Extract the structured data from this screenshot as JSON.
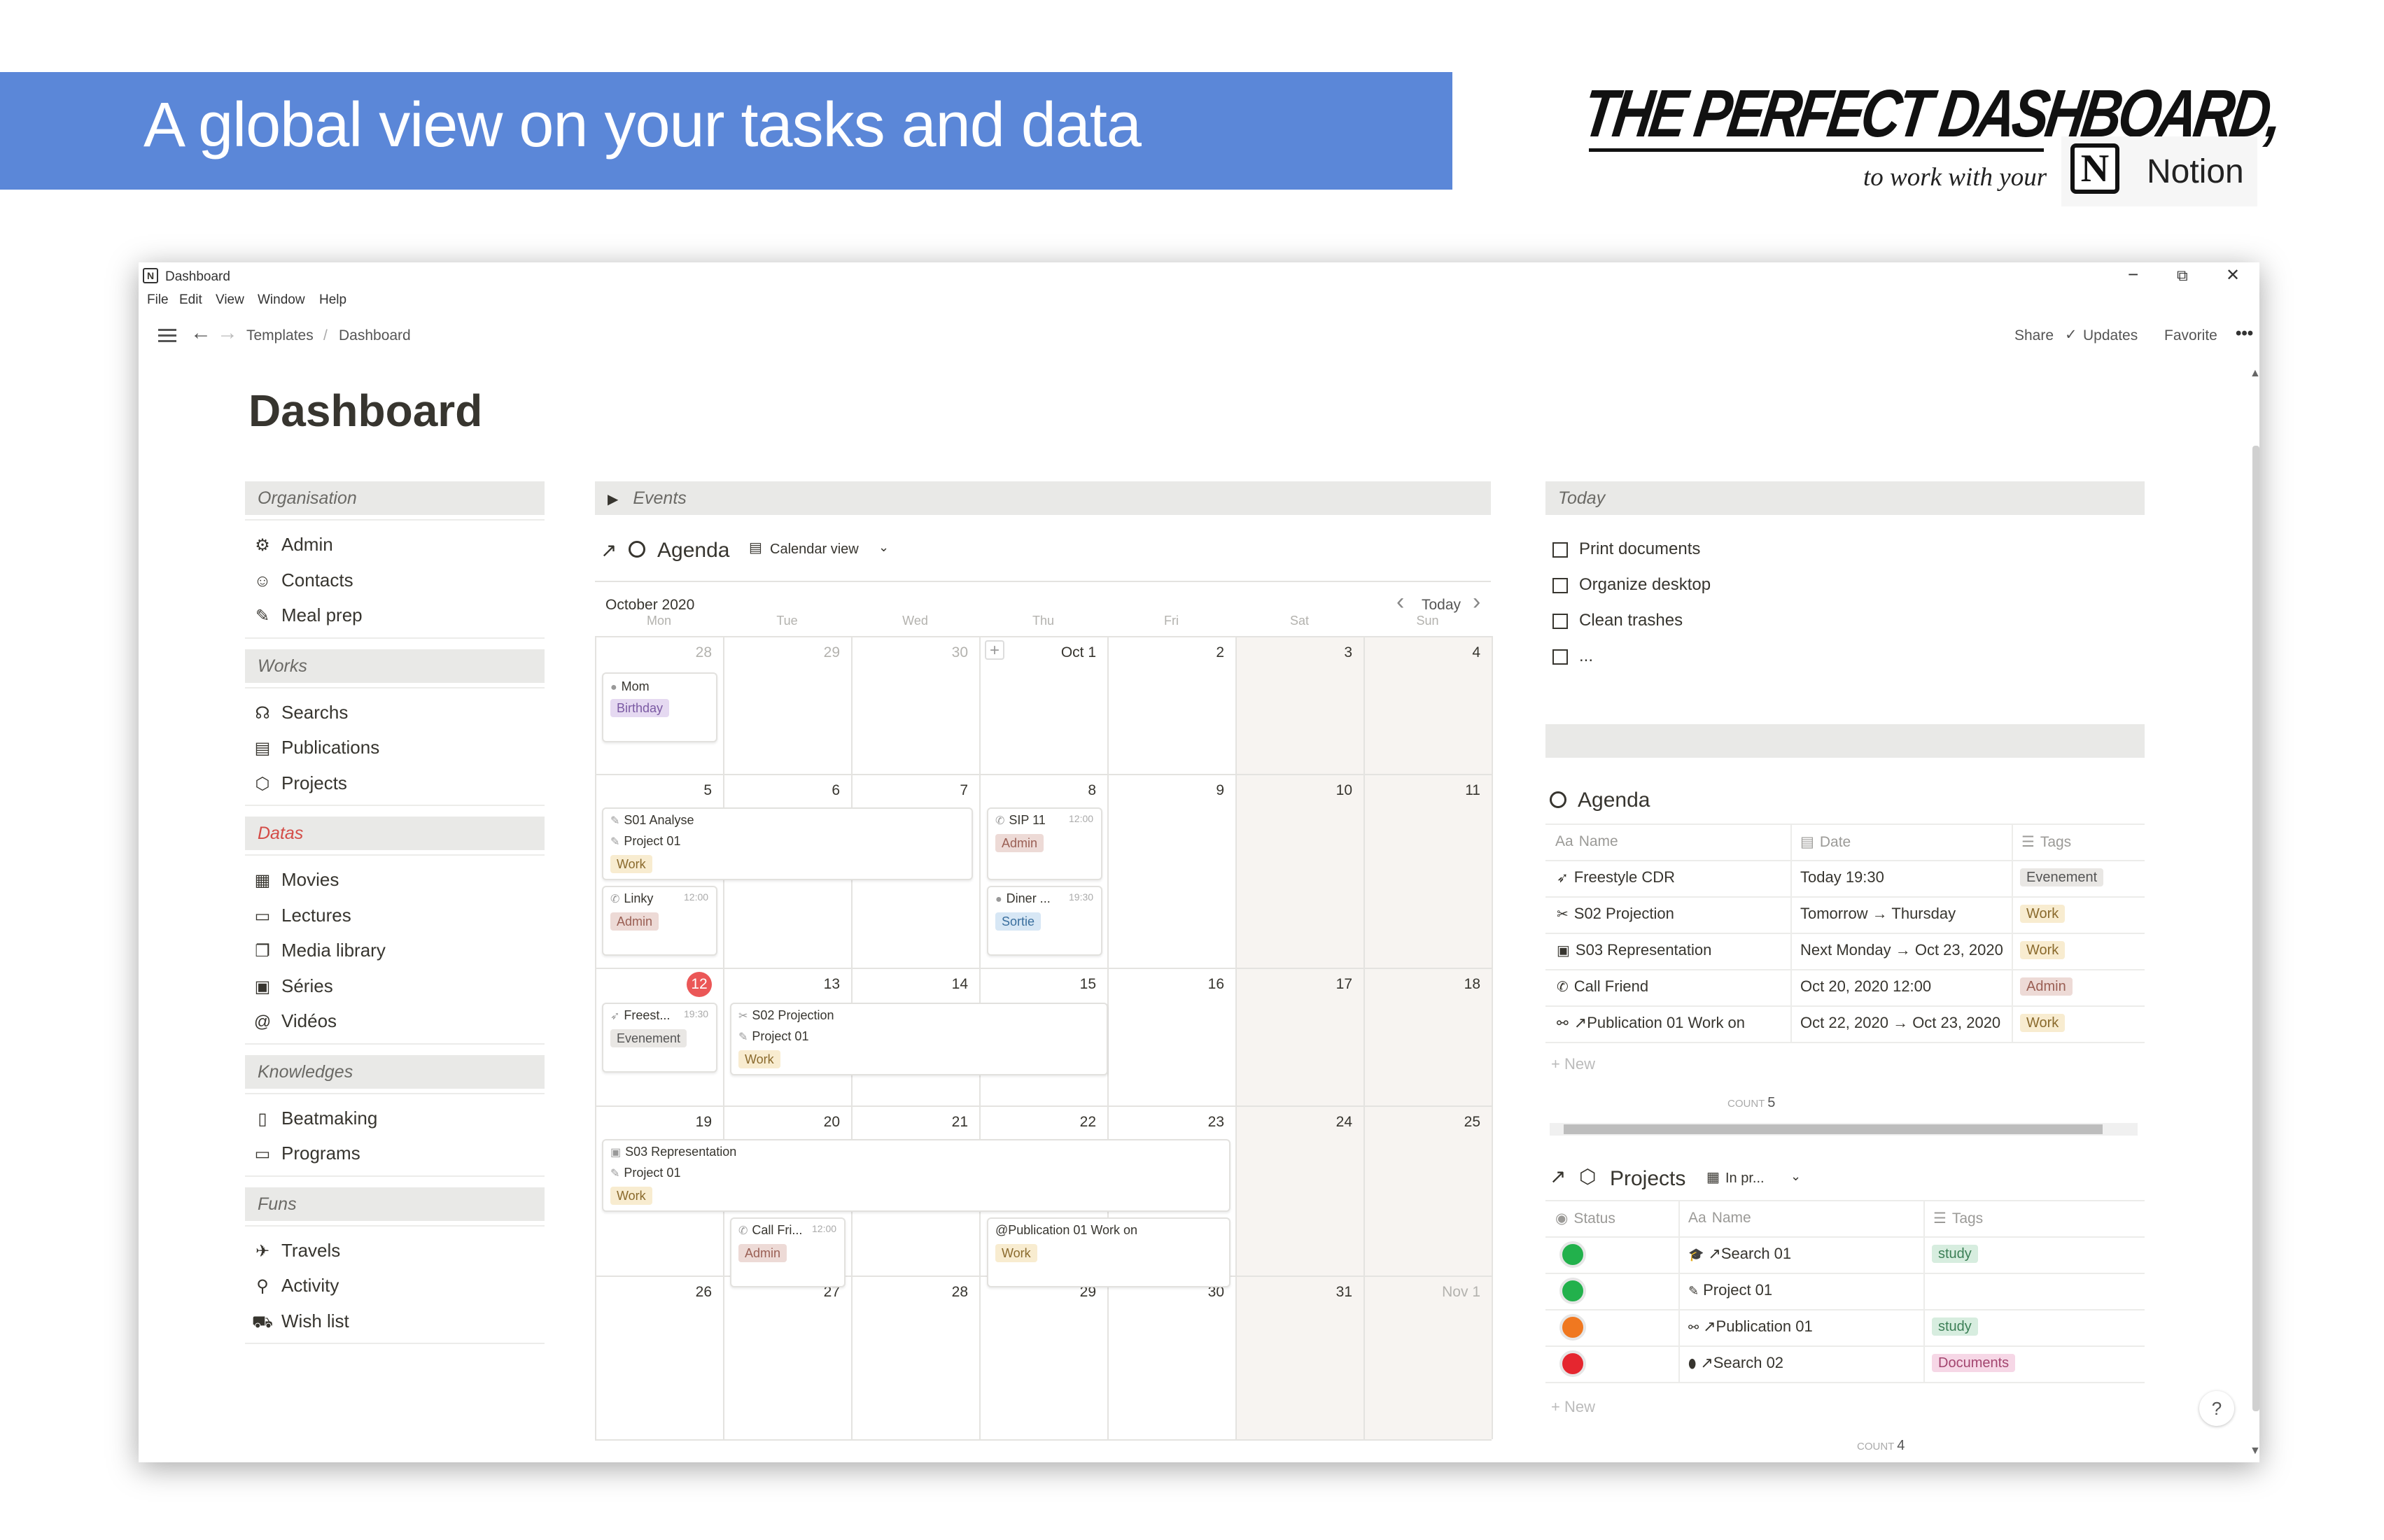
{
  "banner": {
    "title": "A global view on your tasks and data"
  },
  "brand": {
    "title": "THE PERFECT DASHBOARD,",
    "subtitle": "to work with your",
    "notion_logo": "N",
    "notion_word": "Notion"
  },
  "window": {
    "title": "Dashboard",
    "app_icon": "N",
    "menu": [
      "File",
      "Edit",
      "View",
      "Window",
      "Help"
    ],
    "controls": {
      "minimize": "−",
      "restore": "⧉",
      "close": "✕"
    }
  },
  "topbar": {
    "breadcrumb": [
      "Templates",
      "/",
      "Dashboard"
    ],
    "actions": {
      "share": "Share",
      "updates": "Updates",
      "favorite": "Favorite",
      "more": "•••"
    }
  },
  "page": {
    "title": "Dashboard"
  },
  "sidebar": {
    "sections": [
      {
        "title": "Organisation",
        "color": "#6b6a66",
        "items": [
          {
            "icon": "gear-icon",
            "glyph": "⚙",
            "label": "Admin"
          },
          {
            "icon": "person-icon",
            "glyph": "☺",
            "label": "Contacts"
          },
          {
            "icon": "pen-icon",
            "glyph": "✎",
            "label": "Meal prep"
          }
        ]
      },
      {
        "title": "Works",
        "color": "#6b6a66",
        "items": [
          {
            "icon": "headphones-icon",
            "glyph": "☊",
            "label": "Searchs"
          },
          {
            "icon": "clipboard-icon",
            "glyph": "▤",
            "label": "Publications"
          },
          {
            "icon": "cube-icon",
            "glyph": "⬡",
            "label": "Projects"
          }
        ]
      },
      {
        "title": "Datas",
        "color": "#d44c47",
        "items": [
          {
            "icon": "film-icon",
            "glyph": "▦",
            "label": "Movies"
          },
          {
            "icon": "book-icon",
            "glyph": "▭",
            "label": "Lectures"
          },
          {
            "icon": "media-icon",
            "glyph": "❐",
            "label": "Media library"
          },
          {
            "icon": "tv-icon",
            "glyph": "▣",
            "label": "Séries"
          },
          {
            "icon": "at-icon",
            "glyph": "@",
            "label": "Vidéos"
          }
        ]
      },
      {
        "title": "Knowledges",
        "color": "#6b6a66",
        "items": [
          {
            "icon": "speaker-icon",
            "glyph": "▯",
            "label": "Beatmaking"
          },
          {
            "icon": "monitor-icon",
            "glyph": "▭",
            "label": "Programs"
          }
        ]
      },
      {
        "title": "Funs",
        "color": "#6b6a66",
        "items": [
          {
            "icon": "plane-icon",
            "glyph": "✈",
            "label": "Travels"
          },
          {
            "icon": "bike-icon",
            "glyph": "⚲",
            "label": "Activity"
          },
          {
            "icon": "cart-icon",
            "glyph": "⛟",
            "label": "Wish list"
          }
        ]
      }
    ]
  },
  "events": {
    "toggle": "▶",
    "title": "Events"
  },
  "agenda_cal": {
    "arrow": "↗",
    "title": "Agenda",
    "view_label": "Calendar view",
    "month": "October 2020",
    "today": "Today",
    "prev": "‹",
    "next": "›",
    "weekdays": [
      "Mon",
      "Tue",
      "Wed",
      "Thu",
      "Fri",
      "Sat",
      "Sun"
    ],
    "weeks": [
      [
        "28",
        "29",
        "30",
        "Oct 1",
        "2",
        "3",
        "4"
      ],
      [
        "5",
        "6",
        "7",
        "8",
        "9",
        "10",
        "11"
      ],
      [
        "12",
        "13",
        "14",
        "15",
        "16",
        "17",
        "18"
      ],
      [
        "19",
        "20",
        "21",
        "22",
        "23",
        "24",
        "25"
      ],
      [
        "26",
        "27",
        "28",
        "29",
        "30",
        "31",
        "Nov 1"
      ]
    ],
    "add": "+",
    "events": {
      "mom": {
        "title": "Mom",
        "tag": "Birthday"
      },
      "s01": {
        "title": "S01 Analyse",
        "sub": "Project 01",
        "tag": "Work"
      },
      "sip": {
        "title": "SIP 11",
        "time": "12:00",
        "tag": "Admin"
      },
      "linky": {
        "title": "Linky",
        "time": "12:00",
        "tag": "Admin"
      },
      "diner": {
        "title": "Diner ...",
        "time": "19:30",
        "tag": "Sortie"
      },
      "freest": {
        "title": "Freest...",
        "time": "19:30",
        "tag": "Evenement"
      },
      "s02": {
        "title": "S02 Projection",
        "sub": "Project 01",
        "tag": "Work"
      },
      "s03": {
        "title": "S03 Representation",
        "sub": "Project 01",
        "tag": "Work"
      },
      "callfri": {
        "title": "Call Fri...",
        "time": "12:00",
        "tag": "Admin"
      },
      "pub": {
        "title": "@Publication 01 Work on",
        "tag": "Work"
      }
    }
  },
  "today": {
    "title": "Today",
    "tasks": [
      "Print documents",
      "Organize desktop",
      "Clean trashes",
      "..."
    ]
  },
  "agenda_table": {
    "title": "Agenda",
    "columns": [
      "Name",
      "Date",
      "Tags"
    ],
    "rows": [
      {
        "icon": "rocket-icon",
        "glyph": "➶",
        "name": "Freestyle CDR",
        "date": "Today 19:30",
        "tag": "Evenement",
        "tag_class": "tag-event"
      },
      {
        "icon": "tools-icon",
        "glyph": "✂",
        "name": "S02 Projection",
        "date": "Tomorrow → Thursday",
        "tag": "Work",
        "tag_class": "tag-work"
      },
      {
        "icon": "screen-icon",
        "glyph": "▣",
        "name": "S03 Representation",
        "date": "Next Monday → Oct 23, 2020",
        "tag": "Work",
        "tag_class": "tag-work"
      },
      {
        "icon": "phone-icon",
        "glyph": "✆",
        "name": "Call Friend",
        "date": "Oct 20, 2020 12:00",
        "tag": "Admin",
        "tag_class": "tag-admin"
      },
      {
        "icon": "paperclip-icon",
        "glyph": "⚯",
        "name": "↗Publication 01 Work on",
        "date": "Oct 22, 2020 → Oct 23, 2020",
        "tag": "Work",
        "tag_class": "tag-work"
      }
    ],
    "new_label": "New",
    "count_label": "COUNT",
    "count": "5"
  },
  "projects": {
    "arrow": "↗",
    "title": "Projects",
    "view_label": "In pr...",
    "columns": [
      "Status",
      "Name",
      "Tags"
    ],
    "rows": [
      {
        "status_color": "#22b14c",
        "icon": "grad-cap-icon",
        "glyph": "🎓",
        "name": "↗Search 01",
        "tag": "study",
        "tag_class": "tag-study"
      },
      {
        "status_color": "#22b14c",
        "icon": "pen-icon",
        "glyph": "✎",
        "name": "Project 01",
        "tag": "",
        "tag_class": ""
      },
      {
        "status_color": "#f07820",
        "icon": "paperclip-icon",
        "glyph": "⚯",
        "name": "↗Publication 01",
        "tag": "study",
        "tag_class": "tag-study"
      },
      {
        "status_color": "#e5262f",
        "icon": "pill-icon",
        "glyph": "⬮",
        "name": "↗Search 02",
        "tag": "Documents",
        "tag_class": "tag-docs"
      }
    ],
    "new_label": "New",
    "count_label": "COUNT",
    "count": "4"
  },
  "help": "?"
}
